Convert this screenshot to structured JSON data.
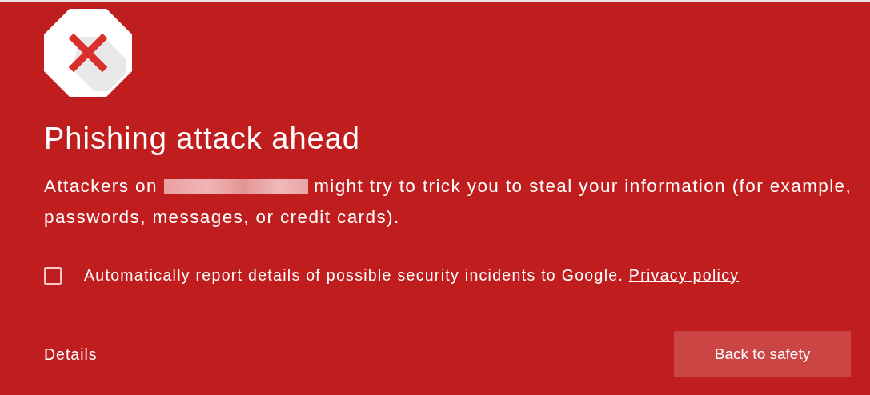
{
  "title": "Phishing attack ahead",
  "message": {
    "before": "Attackers on",
    "redacted": true,
    "after": "might try to trick you to steal your information (for example, passwords, messages, or credit cards)."
  },
  "report": {
    "checked": false,
    "label": "Automatically report details of possible security incidents to Google.",
    "link": "Privacy policy"
  },
  "details_link": "Details",
  "button": "Back to safety"
}
